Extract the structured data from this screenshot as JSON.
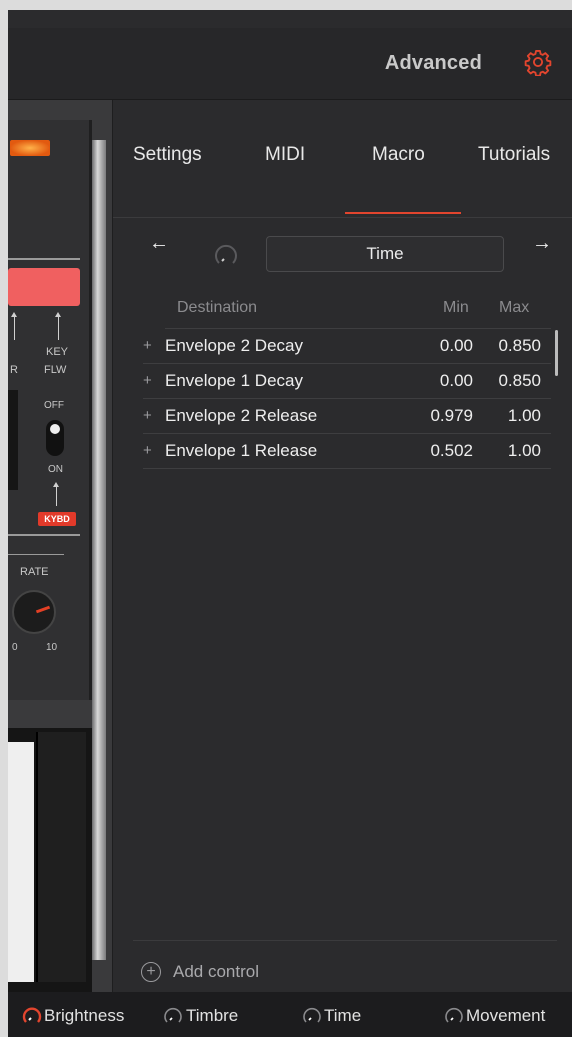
{
  "header": {
    "title": "Advanced",
    "accent_color": "#e2452e",
    "settings_icon": "gear-icon"
  },
  "synth": {
    "key_label": "KEY",
    "flw_label": "FLW",
    "r_label": "R",
    "off_label": "OFF",
    "on_label": "ON",
    "kybd_label": "KYBD",
    "rate_label": "RATE",
    "knob_min": "0",
    "knob_max": "10"
  },
  "tabs": [
    {
      "label": "Settings",
      "active": false
    },
    {
      "label": "MIDI",
      "active": false
    },
    {
      "label": "Macro",
      "active": true
    },
    {
      "label": "Tutorials",
      "active": false
    }
  ],
  "macro_nav": {
    "prev_icon": "arrow-left-icon",
    "next_icon": "arrow-right-icon",
    "prev_glyph": "←",
    "next_glyph": "→",
    "selected_macro": "Time"
  },
  "table": {
    "headers": {
      "destination": "Destination",
      "min": "Min",
      "max": "Max"
    },
    "rows": [
      {
        "destination": "Envelope 2 Decay",
        "min": "0.00",
        "max": "0.850"
      },
      {
        "destination": "Envelope 1 Decay",
        "min": "0.00",
        "max": "0.850"
      },
      {
        "destination": "Envelope 2 Release",
        "min": "0.979",
        "max": "1.00"
      },
      {
        "destination": "Envelope 1 Release",
        "min": "0.502",
        "max": "1.00"
      }
    ],
    "row_prefix": "+"
  },
  "add_control": {
    "label": "Add control",
    "icon_glyph": "+"
  },
  "macros": [
    {
      "label": "Brightness",
      "active": true
    },
    {
      "label": "Timbre",
      "active": false
    },
    {
      "label": "Time",
      "active": false
    },
    {
      "label": "Movement",
      "active": false
    }
  ]
}
